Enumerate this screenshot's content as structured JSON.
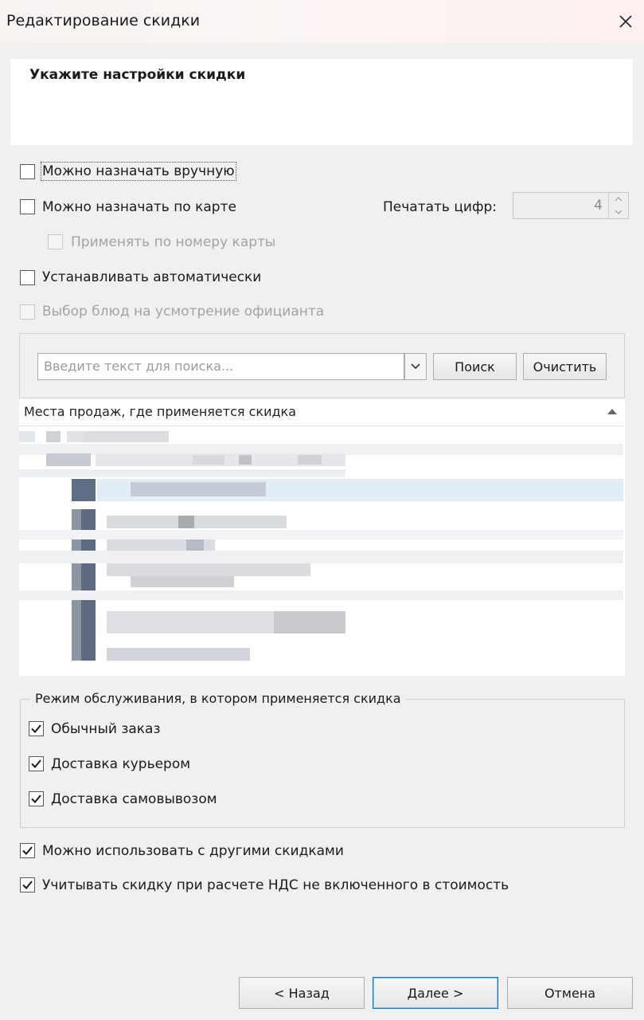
{
  "window": {
    "title": "Редактирование скидки",
    "close_symbol": "✕"
  },
  "header": {
    "heading": "Укажите настройки скидки"
  },
  "options": {
    "manual": {
      "label": "Можно назначать вручную",
      "checked": false
    },
    "by_card": {
      "label": "Можно назначать по карте",
      "checked": false
    },
    "by_card_number": {
      "label": "Применять по номеру карты",
      "checked": false,
      "enabled": false
    },
    "auto": {
      "label": "Устанавливать автоматически",
      "checked": false
    },
    "waiter_choice": {
      "label": "Выбор блюд на усмотрение официанта",
      "checked": false,
      "enabled": false
    }
  },
  "print_digits": {
    "label": "Печатать цифр:",
    "value": "4"
  },
  "search": {
    "placeholder": "Введите текст для поиска...",
    "search_button": "Поиск",
    "clear_button": "Очистить"
  },
  "points_of_sale": {
    "column_header": "Места продаж, где применяется скидка"
  },
  "service_mode": {
    "legend": "Режим обслуживания, в котором применяется скидка",
    "items": [
      {
        "label": "Обычный заказ",
        "checked": true
      },
      {
        "label": "Доставка курьером",
        "checked": true
      },
      {
        "label": "Доставка самовывозом",
        "checked": true
      }
    ]
  },
  "combine": {
    "label": "Можно использовать с другими скидками",
    "checked": true
  },
  "vat": {
    "label": "Учитывать скидку при расчете НДС не включенного в стоимость",
    "checked": true
  },
  "footer": {
    "back": "< Назад",
    "next": "Далее >",
    "cancel": "Отмена"
  }
}
